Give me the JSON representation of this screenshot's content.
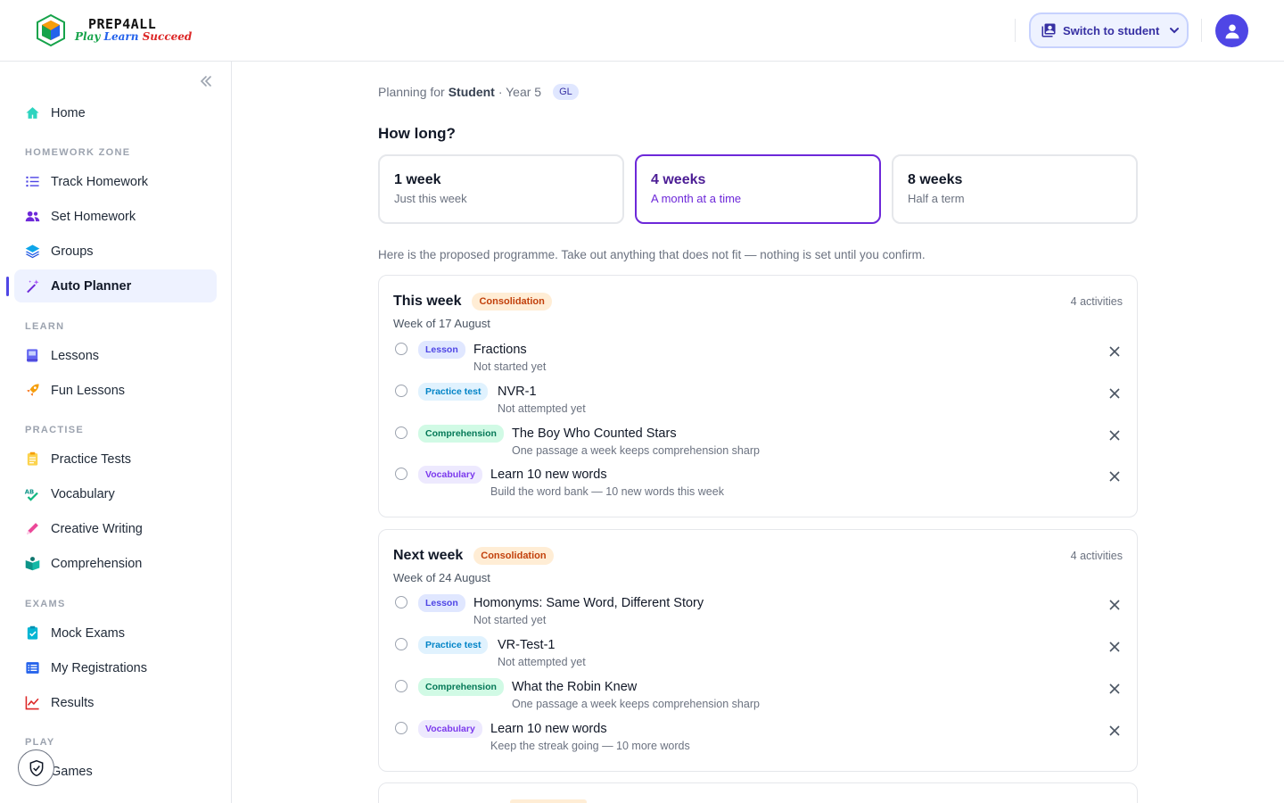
{
  "header": {
    "logo_line1": "PREP4ALL",
    "logo_play": "Play",
    "logo_learn": "Learn",
    "logo_succeed": "Succeed",
    "switch_label": "Switch to student"
  },
  "sidebar": {
    "home": "Home",
    "sections": {
      "homework": "HOMEWORK ZONE",
      "learn": "LEARN",
      "practise": "PRACTISE",
      "exams": "EXAMS",
      "play": "PLAY"
    },
    "items": {
      "track_homework": "Track Homework",
      "set_homework": "Set Homework",
      "groups": "Groups",
      "auto_planner": "Auto Planner",
      "lessons": "Lessons",
      "fun_lessons": "Fun Lessons",
      "practice_tests": "Practice Tests",
      "vocabulary": "Vocabulary",
      "creative_writing": "Creative Writing",
      "comprehension": "Comprehension",
      "mock_exams": "Mock Exams",
      "my_registrations": "My Registrations",
      "results": "Results",
      "games": "Games"
    }
  },
  "main": {
    "planning_prefix": "Planning for",
    "planning_student": "Student",
    "planning_year": "· Year 5",
    "planning_badge": "GL",
    "how_long": "How long?",
    "durations": [
      {
        "title": "1 week",
        "subtitle": "Just this week"
      },
      {
        "title": "4 weeks",
        "subtitle": "A month at a time"
      },
      {
        "title": "8 weeks",
        "subtitle": "Half a term"
      }
    ],
    "selected_duration": "4 weeks",
    "proposal_text": "Here is the proposed programme. Take out anything that does not fit — nothing is set until you confirm.",
    "weeks": [
      {
        "title": "This week",
        "badge": "Consolidation",
        "count": "4 activities",
        "date": "Week of 17 August",
        "activities": [
          {
            "type": "Lesson",
            "title": "Fractions",
            "subtitle": "Not started yet"
          },
          {
            "type": "Practice test",
            "title": "NVR-1",
            "subtitle": "Not attempted yet"
          },
          {
            "type": "Comprehension",
            "title": "The Boy Who Counted Stars",
            "subtitle": "One passage a week keeps comprehension sharp"
          },
          {
            "type": "Vocabulary",
            "title": "Learn 10 new words",
            "subtitle": "Build the word bank — 10 new words this week"
          }
        ]
      },
      {
        "title": "Next week",
        "badge": "Consolidation",
        "count": "4 activities",
        "date": "Week of 24 August",
        "activities": [
          {
            "type": "Lesson",
            "title": "Homonyms: Same Word, Different Story",
            "subtitle": "Not started yet"
          },
          {
            "type": "Practice test",
            "title": "VR-Test-1",
            "subtitle": "Not attempted yet"
          },
          {
            "type": "Comprehension",
            "title": "What the Robin Knew",
            "subtitle": "One passage a week keeps comprehension sharp"
          },
          {
            "type": "Vocabulary",
            "title": "Learn 10 new words",
            "subtitle": "Keep the streak going — 10 more words"
          }
        ]
      }
    ]
  },
  "colors": {
    "accent": "#4f46e5",
    "selected_border": "#6d28d9",
    "consolidation_bg": "#ffedd5",
    "consolidation_text": "#c2410c"
  },
  "icons": {
    "home": "home-icon",
    "track": "checklist-icon",
    "set": "users-icon",
    "groups": "layers-icon",
    "planner": "magic-wand-icon",
    "lessons": "book-icon",
    "fun": "rocket-icon",
    "practice": "clipboard-icon",
    "vocab": "spellcheck-icon",
    "writing": "pencil-icon",
    "comprehension": "open-book-icon",
    "mock": "clipboard-check-icon",
    "registrations": "list-icon",
    "results": "chart-line-icon",
    "shield": "shield-check-icon"
  }
}
